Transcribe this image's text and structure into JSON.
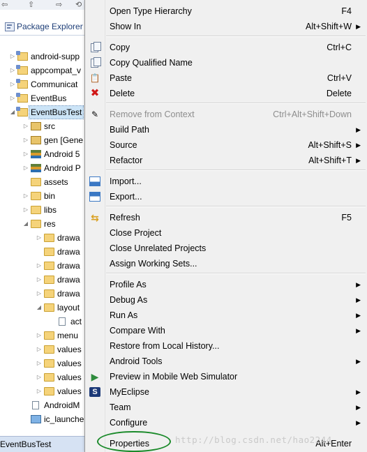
{
  "explorer": {
    "title": "Package Explorer",
    "toolbar_glyphs": [
      "⇦",
      "⇧",
      "⇨",
      "⟲"
    ],
    "status": "EventBusTest",
    "tree": [
      {
        "label": "android-supp",
        "icon": "project-icon",
        "arrow": "▷"
      },
      {
        "label": "appcompat_v",
        "icon": "project-icon",
        "arrow": "▷"
      },
      {
        "label": "Communicat",
        "icon": "project-icon",
        "arrow": "▷"
      },
      {
        "label": "EventBus",
        "icon": "project-icon",
        "arrow": "▷"
      },
      {
        "label": "EventBusTest",
        "icon": "project-icon",
        "arrow": "◢",
        "selected": true
      },
      {
        "label": "src",
        "icon": "source-folder-icon",
        "arrow": "▷"
      },
      {
        "label": "gen [Gene",
        "icon": "source-folder-icon",
        "arrow": "▷"
      },
      {
        "label": "Android 5",
        "icon": "library-icon",
        "arrow": "▷"
      },
      {
        "label": "Android P",
        "icon": "library-icon",
        "arrow": "▷"
      },
      {
        "label": "assets",
        "icon": "folder-icon",
        "arrow": ""
      },
      {
        "label": "bin",
        "icon": "folder-icon",
        "arrow": "▷"
      },
      {
        "label": "libs",
        "icon": "folder-icon",
        "arrow": "▷"
      },
      {
        "label": "res",
        "icon": "folder-icon",
        "arrow": "◢"
      },
      {
        "label": "drawa",
        "icon": "folder-icon",
        "arrow": "▷"
      },
      {
        "label": "drawa",
        "icon": "folder-icon",
        "arrow": ""
      },
      {
        "label": "drawa",
        "icon": "folder-icon",
        "arrow": "▷"
      },
      {
        "label": "drawa",
        "icon": "folder-icon",
        "arrow": "▷"
      },
      {
        "label": "drawa",
        "icon": "folder-icon",
        "arrow": "▷"
      },
      {
        "label": "layout",
        "icon": "folder-icon",
        "arrow": "◢"
      },
      {
        "label": "act",
        "icon": "xml-file-icon",
        "arrow": ""
      },
      {
        "label": "menu",
        "icon": "folder-icon",
        "arrow": "▷"
      },
      {
        "label": "values",
        "icon": "folder-icon",
        "arrow": "▷"
      },
      {
        "label": "values",
        "icon": "folder-icon",
        "arrow": "▷"
      },
      {
        "label": "values",
        "icon": "folder-icon",
        "arrow": "▷"
      },
      {
        "label": "values",
        "icon": "folder-icon",
        "arrow": "▷"
      },
      {
        "label": "AndroidM",
        "icon": "manifest-file-icon",
        "arrow": ""
      },
      {
        "label": "ic_launche",
        "icon": "image-file-icon",
        "arrow": ""
      }
    ]
  },
  "menu": {
    "items": [
      {
        "label": "Open Type Hierarchy",
        "shortcut": "F4",
        "submenu": false,
        "icon": ""
      },
      {
        "label": "Show In",
        "shortcut": "Alt+Shift+W",
        "submenu": true,
        "icon": ""
      },
      {
        "label": "Copy",
        "shortcut": "Ctrl+C",
        "submenu": false,
        "icon": "copy-icon"
      },
      {
        "label": "Copy Qualified Name",
        "shortcut": "",
        "submenu": false,
        "icon": "copy-qualified-icon"
      },
      {
        "label": "Paste",
        "shortcut": "Ctrl+V",
        "submenu": false,
        "icon": "paste-icon"
      },
      {
        "label": "Delete",
        "shortcut": "Delete",
        "submenu": false,
        "icon": "delete-icon"
      },
      {
        "label": "Remove from Context",
        "shortcut": "Ctrl+Alt+Shift+Down",
        "submenu": false,
        "icon": "remove-context-icon",
        "disabled": true
      },
      {
        "label": "Build Path",
        "shortcut": "",
        "submenu": true,
        "icon": ""
      },
      {
        "label": "Source",
        "shortcut": "Alt+Shift+S",
        "submenu": true,
        "icon": ""
      },
      {
        "label": "Refactor",
        "shortcut": "Alt+Shift+T",
        "submenu": true,
        "icon": ""
      },
      {
        "label": "Import...",
        "shortcut": "",
        "submenu": false,
        "icon": "import-icon"
      },
      {
        "label": "Export...",
        "shortcut": "",
        "submenu": false,
        "icon": "export-icon"
      },
      {
        "label": "Refresh",
        "shortcut": "F5",
        "submenu": false,
        "icon": "refresh-icon"
      },
      {
        "label": "Close Project",
        "shortcut": "",
        "submenu": false,
        "icon": ""
      },
      {
        "label": "Close Unrelated Projects",
        "shortcut": "",
        "submenu": false,
        "icon": ""
      },
      {
        "label": "Assign Working Sets...",
        "shortcut": "",
        "submenu": false,
        "icon": ""
      },
      {
        "label": "Profile As",
        "shortcut": "",
        "submenu": true,
        "icon": ""
      },
      {
        "label": "Debug As",
        "shortcut": "",
        "submenu": true,
        "icon": ""
      },
      {
        "label": "Run As",
        "shortcut": "",
        "submenu": true,
        "icon": ""
      },
      {
        "label": "Compare With",
        "shortcut": "",
        "submenu": true,
        "icon": ""
      },
      {
        "label": "Restore from Local History...",
        "shortcut": "",
        "submenu": false,
        "icon": ""
      },
      {
        "label": "Android Tools",
        "shortcut": "",
        "submenu": true,
        "icon": ""
      },
      {
        "label": "Preview in Mobile Web Simulator",
        "shortcut": "",
        "submenu": false,
        "icon": "preview-icon"
      },
      {
        "label": "MyEclipse",
        "shortcut": "",
        "submenu": true,
        "icon": "myeclipse-icon"
      },
      {
        "label": "Team",
        "shortcut": "",
        "submenu": true,
        "icon": ""
      },
      {
        "label": "Configure",
        "shortcut": "",
        "submenu": true,
        "icon": ""
      },
      {
        "label": "Properties",
        "shortcut": "Alt+Enter",
        "submenu": false,
        "icon": ""
      }
    ],
    "watermark": "http://blog.csdn.net/hao2244",
    "colors": {
      "menu_bg": "#f0f0f0",
      "selection": "#cce4f7",
      "annotation_circle": "#1a8a2a"
    }
  }
}
